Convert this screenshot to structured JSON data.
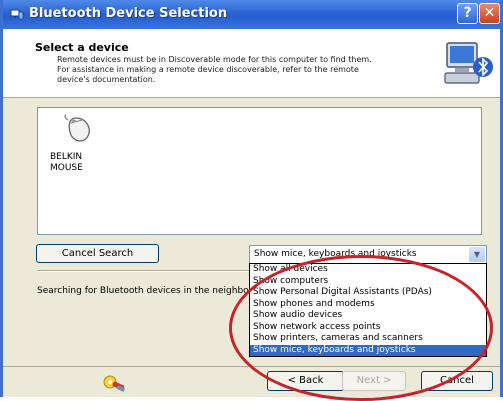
{
  "window": {
    "title": "Bluetooth Device Selection",
    "help_label": "?",
    "close_label": "✕"
  },
  "header": {
    "title": "Select a device",
    "description": [
      "Remote devices must be in Discoverable mode for this computer to find them.",
      "For assistance in making a remote device discoverable, refer to the remote",
      "device's documentation."
    ]
  },
  "devices": [
    {
      "name_line1": "BELKIN",
      "name_line2": "MOUSE",
      "icon": "mouse-icon"
    }
  ],
  "cancel_search_label": "Cancel Search",
  "filter": {
    "selected": "Show mice, keyboards and joysticks",
    "arrow": "▼"
  },
  "dropdown_options": [
    "Show all devices",
    "Show computers",
    "Show Personal Digital Assistants (PDAs)",
    "Show phones and modems",
    "Show audio devices",
    "Show network access points",
    "Show printers, cameras and scanners",
    "Show mice, keyboards and joysticks"
  ],
  "dropdown_selected_index": 7,
  "status_text": "Searching for Bluetooth devices in the neighborhood...",
  "buttons": {
    "back": "< Back",
    "next": "Next >",
    "cancel": "Cancel"
  },
  "colors": {
    "titlebar": "#245ecf",
    "selection": "#316ac5",
    "annotation_circle": "#c8232c"
  }
}
